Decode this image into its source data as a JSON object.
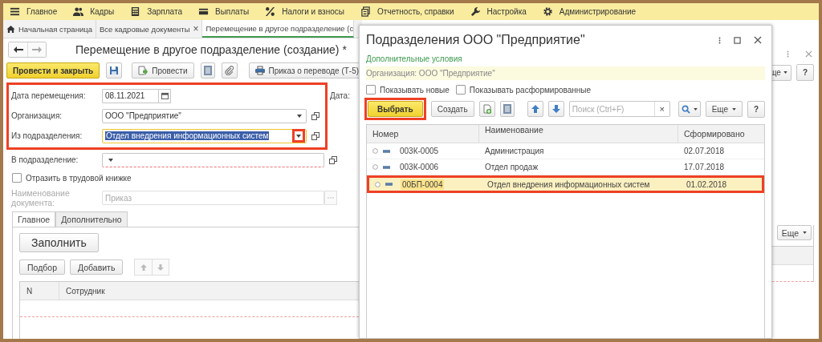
{
  "menu": [
    {
      "label": "Главное",
      "kind": "menu"
    },
    {
      "label": "Кадры",
      "kind": "people"
    },
    {
      "label": "Зарплата",
      "kind": "calculator"
    },
    {
      "label": "Выплаты",
      "kind": "card"
    },
    {
      "label": "Налоги и взносы",
      "kind": "percent"
    },
    {
      "label": "Отчетность, справки",
      "kind": "docs"
    },
    {
      "label": "Настройка",
      "kind": "wrench"
    },
    {
      "label": "Администрирование",
      "kind": "gear"
    }
  ],
  "tabs": [
    {
      "label": "Начальная страница",
      "kind": "home",
      "selected": false
    },
    {
      "label": "Все кадровые документы",
      "kind": "closable",
      "close": "×",
      "selected": false
    },
    {
      "label": "Перемещение в другое подразделение (с",
      "kind": "plain",
      "selected": true
    }
  ],
  "document": {
    "title": "Перемещение в другое подразделение (создание)",
    "modified_mark": "*",
    "post_close_button": "Провести и закрыть",
    "post_button": "Провести",
    "print_button": "Приказ о переводе (Т-5)",
    "fields_annotated": true,
    "fields": [
      {
        "label": "Дата перемещения:",
        "value": "08.11.2021",
        "kind": "date"
      },
      {
        "label": "Организация:",
        "value": "ООО \"Предприятие\"",
        "kind": "select"
      },
      {
        "label": "Из подразделения:",
        "value": "Отдел внедрения информационных систем",
        "kind": "select",
        "focused": true,
        "dropdown_annotated": true
      }
    ],
    "side_label": "Дата:",
    "target_field": {
      "label": "В подразделение:",
      "required": true
    },
    "reflect_checkbox": {
      "label": "Отразить в трудовой книжке",
      "checked": false
    },
    "doc_name_field": {
      "label": "Наименование документа:",
      "value": "Приказ",
      "disabled": true
    },
    "inner_tabs": [
      {
        "label": "Главное",
        "selected": true
      },
      {
        "label": "Дополнительно",
        "selected": false
      }
    ],
    "fill_button": "Заполнить",
    "pick_button": "Подбор",
    "add_button": "Добавить",
    "columns": [
      "N",
      "Сотрудник"
    ],
    "right_top_more": "ще",
    "right_top_help": "?",
    "right_more": "Еще"
  },
  "dialog": {
    "title": "Подразделения ООО \"Предприятие\"",
    "conditions_link": "Дополнительные условия",
    "filter": "Организация: ООО \"Предприятие\"",
    "checkboxes": [
      {
        "label": "Показывать новые",
        "checked": false
      },
      {
        "label": "Показывать расформированные",
        "checked": false
      }
    ],
    "select_button": "Выбрать",
    "select_annotated": true,
    "create_button": "Создать",
    "search_placeholder": "Поиск (Ctrl+F)",
    "clear": "×",
    "more_button": "Еще",
    "help_button": "?",
    "columns": [
      "Номер",
      "Наименование",
      "Сформировано"
    ],
    "rows": [
      {
        "number": "003К-0005",
        "name": "Администрация",
        "date": "02.07.2018",
        "selected": false,
        "annotated": false
      },
      {
        "number": "003К-0006",
        "name": "Отдел продаж",
        "date": "17.07.2018",
        "selected": false,
        "annotated": false
      },
      {
        "number": "00БП-0004",
        "name": "Отдел внедрения информационных систем",
        "date": "01.02.2018",
        "selected": true,
        "annotated": true
      }
    ]
  }
}
